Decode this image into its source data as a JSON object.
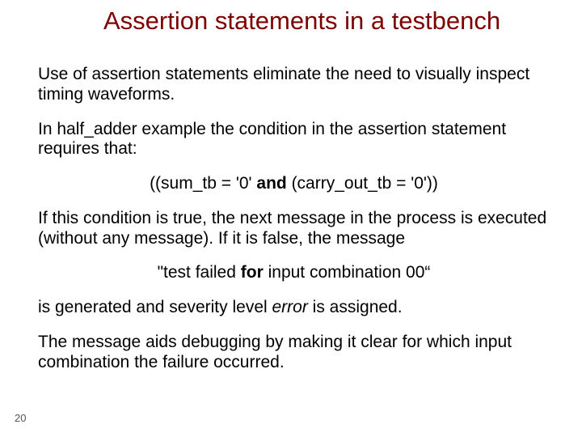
{
  "title": "Assertion statements in a testbench",
  "p1": "Use of assertion statements eliminate the need to visually inspect timing waveforms.",
  "p2": "In half_adder example the condition in the assertion statement requires that:",
  "code_pre": "((sum_tb = '0' ",
  "code_bold": "and",
  "code_post": " (carry_out_tb = '0'))",
  "p3": "If this condition is true, the next message in the process is executed (without any message). If it is false, the message",
  "msg_pre": "\"test failed ",
  "msg_bold": "for",
  "msg_post": " input combination 00“",
  "p4_pre": "is generated and severity level ",
  "p4_err": "error",
  "p4_post": " is assigned.",
  "p5": "The message aids debugging by making it clear for which input combination the failure occurred.",
  "page": "20"
}
